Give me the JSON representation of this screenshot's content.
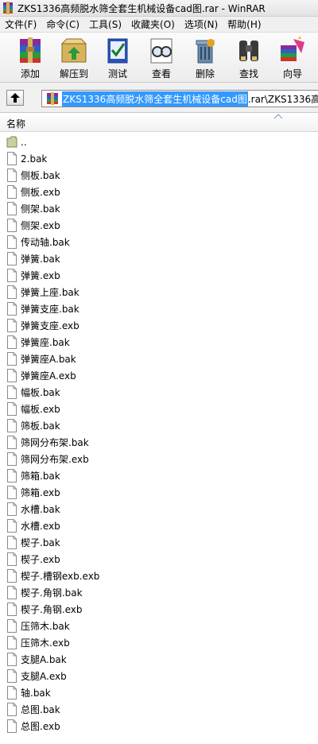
{
  "window": {
    "title": "ZKS1336高频脱水筛全套生机械设备cad图.rar - WinRAR"
  },
  "menu": [
    {
      "id": "file",
      "label": "文件(F)"
    },
    {
      "id": "commands",
      "label": "命令(C)"
    },
    {
      "id": "tools",
      "label": "工具(S)"
    },
    {
      "id": "favorites",
      "label": "收藏夹(O)"
    },
    {
      "id": "options",
      "label": "选项(N)"
    },
    {
      "id": "help",
      "label": "帮助(H)"
    }
  ],
  "toolbar": [
    {
      "id": "add",
      "label": "添加",
      "icon": "add-archive-icon"
    },
    {
      "id": "extract",
      "label": "解压到",
      "icon": "extract-to-icon"
    },
    {
      "id": "test",
      "label": "测试",
      "icon": "test-icon"
    },
    {
      "id": "view",
      "label": "查看",
      "icon": "view-icon"
    },
    {
      "id": "delete",
      "label": "删除",
      "icon": "delete-icon"
    },
    {
      "id": "find",
      "label": "查找",
      "icon": "find-icon"
    },
    {
      "id": "wizard",
      "label": "向导",
      "icon": "wizard-icon"
    }
  ],
  "address": {
    "selected": "ZKS1336高频脱水筛全套生机械设备cad图",
    "rest": ".rar\\ZKS1336高频"
  },
  "columns": {
    "name": "名称"
  },
  "files": [
    {
      "name": "..",
      "type": "folder"
    },
    {
      "name": "2.bak",
      "type": "file"
    },
    {
      "name": "侧板.bak",
      "type": "file"
    },
    {
      "name": "侧板.exb",
      "type": "file"
    },
    {
      "name": "侧架.bak",
      "type": "file"
    },
    {
      "name": "侧架.exb",
      "type": "file"
    },
    {
      "name": "传动轴.bak",
      "type": "file"
    },
    {
      "name": "弹簧.bak",
      "type": "file"
    },
    {
      "name": "弹簧.exb",
      "type": "file"
    },
    {
      "name": "弹簧上座.bak",
      "type": "file"
    },
    {
      "name": "弹簧支座.bak",
      "type": "file"
    },
    {
      "name": "弹簧支座.exb",
      "type": "file"
    },
    {
      "name": "弹簧座.bak",
      "type": "file"
    },
    {
      "name": "弹簧座A.bak",
      "type": "file"
    },
    {
      "name": "弹簧座A.exb",
      "type": "file"
    },
    {
      "name": "幅板.bak",
      "type": "file"
    },
    {
      "name": "幅板.exb",
      "type": "file"
    },
    {
      "name": "筛板.bak",
      "type": "file"
    },
    {
      "name": "筛网分布架.bak",
      "type": "file"
    },
    {
      "name": "筛网分布架.exb",
      "type": "file"
    },
    {
      "name": "筛箱.bak",
      "type": "file"
    },
    {
      "name": "筛箱.exb",
      "type": "file"
    },
    {
      "name": "水槽.bak",
      "type": "file"
    },
    {
      "name": "水槽.exb",
      "type": "file"
    },
    {
      "name": "楔子.bak",
      "type": "file"
    },
    {
      "name": "楔子.exb",
      "type": "file"
    },
    {
      "name": "楔子.槽钢exb.exb",
      "type": "file"
    },
    {
      "name": "楔子.角钢.bak",
      "type": "file"
    },
    {
      "name": "楔子.角钢.exb",
      "type": "file"
    },
    {
      "name": "压筛木.bak",
      "type": "file"
    },
    {
      "name": "压筛木.exb",
      "type": "file"
    },
    {
      "name": "支腿A.bak",
      "type": "file"
    },
    {
      "name": "支腿A.exb",
      "type": "file"
    },
    {
      "name": "轴.bak",
      "type": "file"
    },
    {
      "name": "总图.bak",
      "type": "file"
    },
    {
      "name": "总图.exb",
      "type": "file"
    }
  ]
}
